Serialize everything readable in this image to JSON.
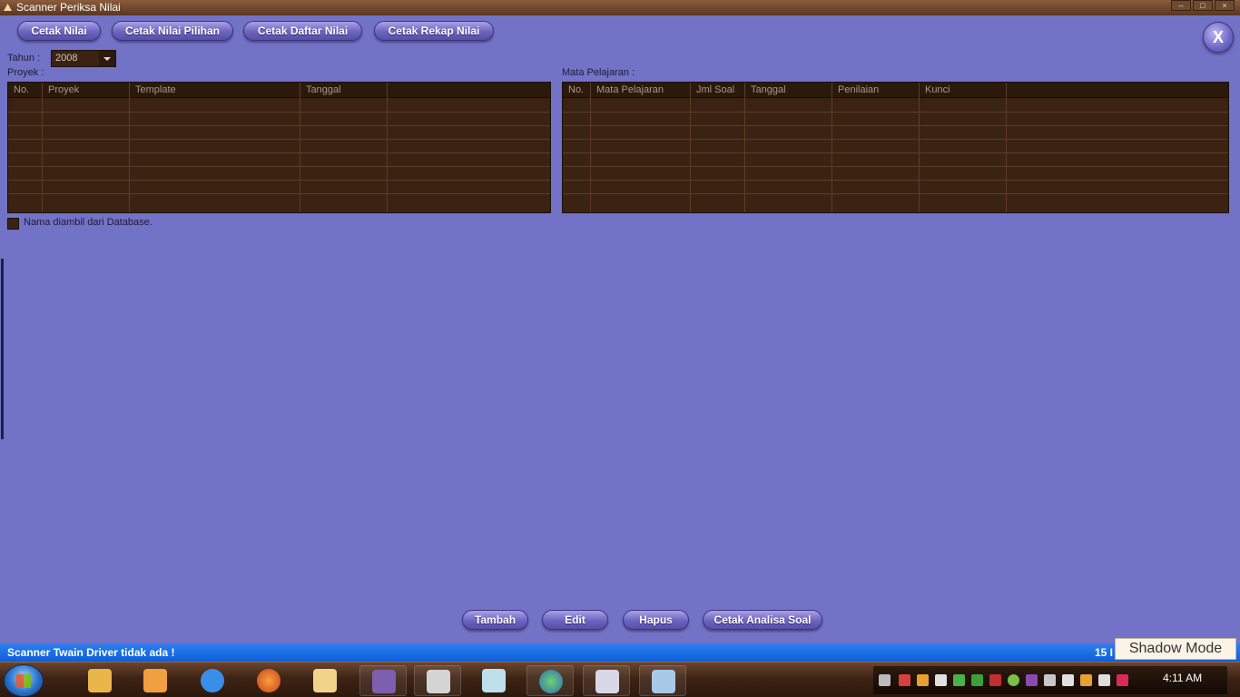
{
  "window": {
    "title": "Scanner Periksa Nilai",
    "close_label": "X"
  },
  "top_buttons": [
    "Cetak Nilai",
    "Cetak Nilai Pilihan",
    "Cetak Daftar Nilai",
    "Cetak Rekap Nilai"
  ],
  "filter": {
    "year_label": "Tahun  :",
    "year_value": "2008"
  },
  "proyek": {
    "label": "Proyek :",
    "columns": [
      "No.",
      "Proyek",
      "Template",
      "Tanggal",
      ""
    ]
  },
  "mapel": {
    "label": "Mata Pelajaran :",
    "columns": [
      "No.",
      "Mata Pelajaran",
      "Jml Soal",
      "Tanggal",
      "Penilaian",
      "Kunci",
      ""
    ]
  },
  "options": {
    "db_name_label": "Nama diambil dari Database."
  },
  "bottom_buttons": [
    "Tambah",
    "Edit",
    "Hapus",
    "Cetak Analisa Soal"
  ],
  "status": {
    "message": "Scanner Twain Driver tidak ada !",
    "right_text": "15 I"
  },
  "overlay": {
    "shadow_mode": "Shadow Mode"
  },
  "taskbar": {
    "clock": "4:11 AM",
    "apps": [
      "file-explorer",
      "media-player",
      "internet-explorer",
      "firefox",
      "notepad",
      "media-center",
      "window-switcher",
      "paper-app",
      "globe-app",
      "ship-app",
      "image-viewer"
    ]
  }
}
